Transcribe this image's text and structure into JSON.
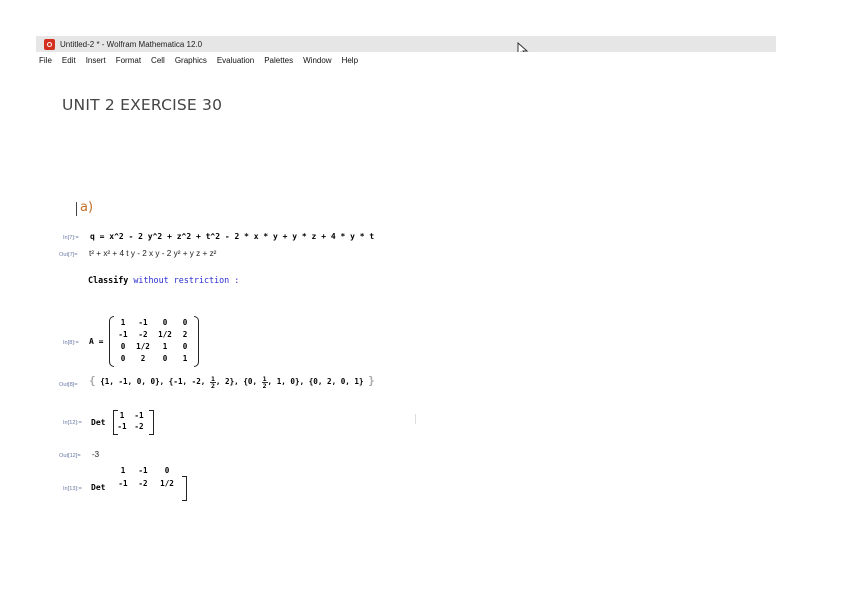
{
  "window": {
    "title": "Untitled-2 * - Wolfram Mathematica 12.0"
  },
  "menu": [
    "File",
    "Edit",
    "Insert",
    "Format",
    "Cell",
    "Graphics",
    "Evaluation",
    "Palettes",
    "Window",
    "Help"
  ],
  "notebook": {
    "title": "UNIT 2 EXERCISE 30",
    "section": "a)",
    "cells": {
      "in7_label": "In[7]:=",
      "in7_code": "q = x^2 - 2 y^2 + z^2 + t^2 - 2 * x * y + y * z + 4 * y * t",
      "out7_label": "Out[7]=",
      "out7_text": "t² + x² + 4 t y - 2 x y - 2 y² + y z + z²",
      "text_bold1": "Classify",
      "text_kw1": "without",
      "text_kw2": "restriction",
      "text_end": " :",
      "in8_label": "In[8]:=",
      "in8_prefix": "A =",
      "in8_matrix": [
        [
          "1",
          "-1",
          "0",
          "0"
        ],
        [
          "-1",
          "-2",
          "1/2",
          "2"
        ],
        [
          "0",
          "1/2",
          "1",
          "0"
        ],
        [
          "0",
          "2",
          "0",
          "1"
        ]
      ],
      "out8_label": "Out[8]=",
      "out8_rows": [
        "{1, -1, 0, 0}",
        "{-1, -2, ",
        ", 2}",
        "{0, ",
        ", 1, 0}",
        "{0, 2, 0, 1}"
      ],
      "out8_frac_num": "1",
      "out8_frac_den": "2",
      "in12_label": "In[12]:=",
      "in12_prefix": "Det",
      "in12_matrix": [
        [
          "1",
          "-1"
        ],
        [
          "-1",
          "-2"
        ]
      ],
      "out12_label": "Out[12]=",
      "out12_value": "-3",
      "in13_label": "In[13]:=",
      "in13_prefix": "Det",
      "in13_matrix": [
        [
          "1",
          "-1",
          "0"
        ],
        [
          "-1",
          "-2",
          "1/2"
        ]
      ]
    }
  },
  "colors": {
    "section": "#c2722b",
    "keyword": "#2b2dd0",
    "label": "#6a7aa6"
  }
}
